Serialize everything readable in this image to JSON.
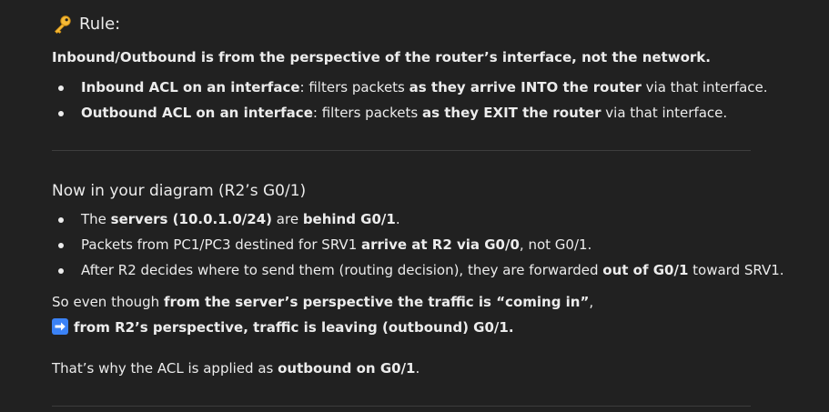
{
  "rule": {
    "icon": "key-icon",
    "title": "Rule:",
    "lead": "Inbound/Outbound is from the perspective of the router’s interface, not the network.",
    "items": [
      {
        "b1": "Inbound ACL on an interface",
        "t1": ": filters packets ",
        "b2": "as they arrive INTO the router",
        "t2": " via that interface."
      },
      {
        "b1": "Outbound ACL on an interface",
        "t1": ": filters packets ",
        "b2": "as they EXIT the router",
        "t2": " via that interface."
      }
    ]
  },
  "diagram": {
    "title": "Now in your diagram (R2’s G0/1)",
    "item1": {
      "t1": "The ",
      "b1": "servers (10.0.1.0/24)",
      "t2": " are ",
      "b2": "behind G0/1",
      "t3": "."
    },
    "item2": {
      "t1": "Packets from PC1/PC3 destined for SRV1 ",
      "b1": "arrive at R2 via G0/0",
      "t2": ", not G0/1."
    },
    "item3": {
      "t1": "After R2 decides where to send them (routing decision), they are forwarded ",
      "b1": "out of G0/1",
      "t2": " toward SRV1."
    }
  },
  "conclusion": {
    "line1": {
      "t1": "So even though ",
      "b1": "from the server’s perspective the traffic is “coming in”",
      "t2": ","
    },
    "line2": {
      "icon": "right-arrow-icon",
      "b1": "from R2’s perspective, traffic is leaving (outbound) G0/1."
    },
    "line3": {
      "t1": "That’s why the ACL is applied as ",
      "b1": "outbound on G0/1",
      "t2": "."
    }
  },
  "colors": {
    "background": "#212121",
    "text": "#ececec",
    "divider": "#3d3d3d",
    "arrow_icon_bg": "#3b82f6"
  }
}
